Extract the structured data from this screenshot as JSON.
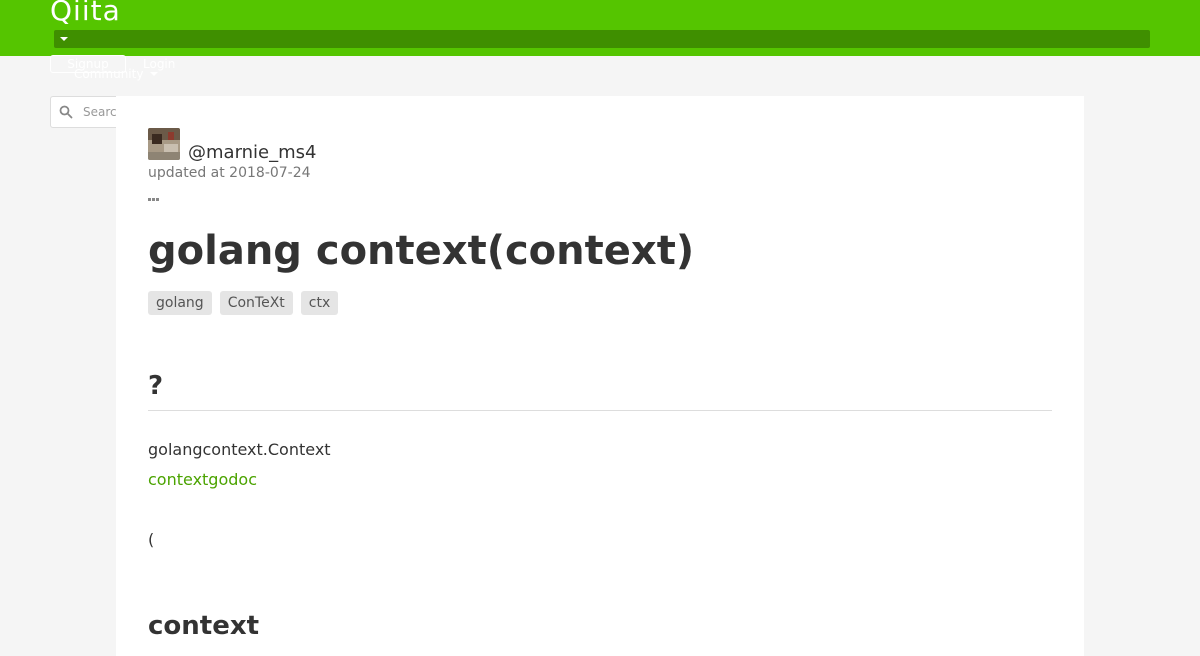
{
  "header": {
    "logo_text": "Qiita",
    "brand_color": "#55c500",
    "signup_label": "Signup",
    "login_label": "Login",
    "community_label": "Community"
  },
  "search": {
    "placeholder": "Search"
  },
  "article": {
    "author": "@marnie_ms4",
    "updated_at": "updated at 2018-07-24",
    "title": "golang context(context)",
    "tags": [
      {
        "label": "golang"
      },
      {
        "label": "ConTeXt"
      },
      {
        "label": "ctx"
      }
    ],
    "body": {
      "heading_1": "?",
      "paragraph_1": "golangcontext.Context",
      "link_1": "contextgodoc",
      "paragraph_2": "(",
      "heading_2": "context"
    },
    "link_color": "#4ba300"
  }
}
